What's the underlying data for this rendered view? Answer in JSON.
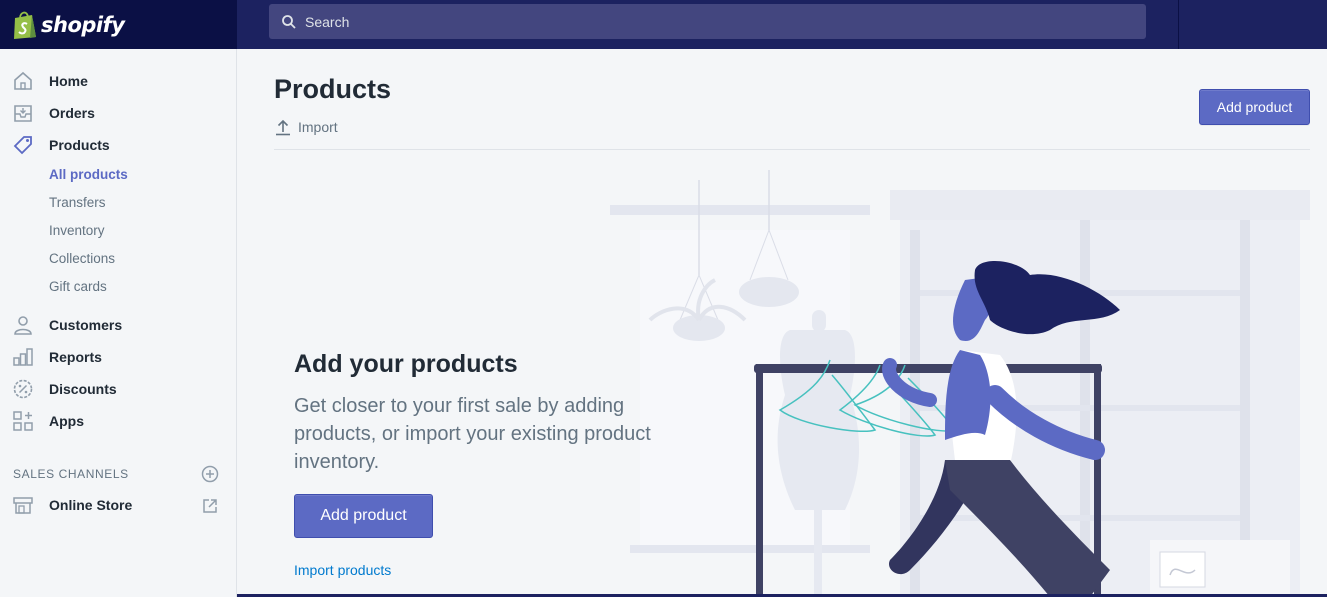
{
  "brand": {
    "name": "shopify",
    "color": "#95bf47"
  },
  "search": {
    "placeholder": "Search"
  },
  "sidebar": {
    "items": [
      {
        "label": "Home",
        "icon": "home-icon"
      },
      {
        "label": "Orders",
        "icon": "orders-icon"
      },
      {
        "label": "Products",
        "icon": "tag-icon"
      },
      {
        "label": "Customers",
        "icon": "person-icon"
      },
      {
        "label": "Reports",
        "icon": "bar-chart-icon"
      },
      {
        "label": "Discounts",
        "icon": "discount-icon"
      },
      {
        "label": "Apps",
        "icon": "apps-icon"
      }
    ],
    "product_subitems": [
      "All products",
      "Transfers",
      "Inventory",
      "Collections",
      "Gift cards"
    ],
    "active_subitem": "All products",
    "sales_channels": {
      "title": "SALES CHANNELS",
      "items": [
        {
          "label": "Online Store",
          "icon": "store-icon"
        }
      ]
    }
  },
  "page": {
    "title": "Products",
    "import_label": "Import",
    "add_product_label": "Add product"
  },
  "empty_state": {
    "heading": "Add your products",
    "text": "Get closer to your first sale by adding products, or import your existing product inventory.",
    "button_label": "Add product",
    "link_label": "Import products"
  },
  "colors": {
    "topbar": "#1c2260",
    "logo_area": "#0b1045",
    "accent": "#5c6ac4",
    "link": "#007ace"
  }
}
